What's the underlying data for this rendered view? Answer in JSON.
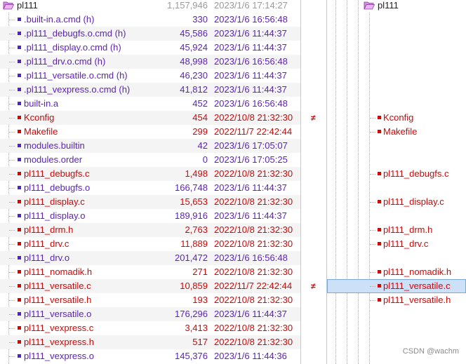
{
  "colors": {
    "changed": "#e00000",
    "unique": "#5a1ec8",
    "same": "#202020",
    "muted": "#9a9a9a",
    "folder": "#c87ad8"
  },
  "left": {
    "folder": {
      "name": "pl111",
      "size": "1,157,946",
      "date": "2023/1/6 17:14:27"
    },
    "rows": [
      {
        "name": ".built-in.a.cmd (h)",
        "size": "330",
        "date": "2023/1/6 16:56:48",
        "status": "unique"
      },
      {
        "name": ".pl111_debugfs.o.cmd (h)",
        "size": "45,586",
        "date": "2023/1/6 11:44:37",
        "status": "unique"
      },
      {
        "name": ".pl111_display.o.cmd (h)",
        "size": "45,924",
        "date": "2023/1/6 11:44:37",
        "status": "unique"
      },
      {
        "name": ".pl111_drv.o.cmd (h)",
        "size": "48,998",
        "date": "2023/1/6 16:56:48",
        "status": "unique"
      },
      {
        "name": ".pl111_versatile.o.cmd (h)",
        "size": "46,230",
        "date": "2023/1/6 11:44:37",
        "status": "unique"
      },
      {
        "name": ".pl111_vexpress.o.cmd (h)",
        "size": "41,812",
        "date": "2023/1/6 11:44:37",
        "status": "unique"
      },
      {
        "name": "built-in.a",
        "size": "452",
        "date": "2023/1/6 16:56:48",
        "status": "unique"
      },
      {
        "name": "Kconfig",
        "size": "454",
        "date": "2022/10/8 21:32:30",
        "status": "changed"
      },
      {
        "name": "Makefile",
        "size": "299",
        "date": "2022/11/7 22:42:44",
        "status": "changed"
      },
      {
        "name": "modules.builtin",
        "size": "42",
        "date": "2023/1/6 17:05:07",
        "status": "unique"
      },
      {
        "name": "modules.order",
        "size": "0",
        "date": "2023/1/6 17:05:25",
        "status": "unique"
      },
      {
        "name": "pl111_debugfs.c",
        "size": "1,498",
        "date": "2022/10/8 21:32:30",
        "status": "changed"
      },
      {
        "name": "pl111_debugfs.o",
        "size": "166,748",
        "date": "2023/1/6 11:44:37",
        "status": "unique"
      },
      {
        "name": "pl111_display.c",
        "size": "15,653",
        "date": "2022/10/8 21:32:30",
        "status": "changed"
      },
      {
        "name": "pl111_display.o",
        "size": "189,916",
        "date": "2023/1/6 11:44:37",
        "status": "unique"
      },
      {
        "name": "pl111_drm.h",
        "size": "2,763",
        "date": "2022/10/8 21:32:30",
        "status": "changed"
      },
      {
        "name": "pl111_drv.c",
        "size": "11,889",
        "date": "2022/10/8 21:32:30",
        "status": "changed"
      },
      {
        "name": "pl111_drv.o",
        "size": "201,472",
        "date": "2023/1/6 16:56:48",
        "status": "unique"
      },
      {
        "name": "pl111_nomadik.h",
        "size": "271",
        "date": "2022/10/8 21:32:30",
        "status": "changed"
      },
      {
        "name": "pl111_versatile.c",
        "size": "10,859",
        "date": "2022/11/7 22:42:44",
        "status": "changed"
      },
      {
        "name": "pl111_versatile.h",
        "size": "193",
        "date": "2022/10/8 21:32:30",
        "status": "changed"
      },
      {
        "name": "pl111_versatile.o",
        "size": "176,296",
        "date": "2023/1/6 11:44:37",
        "status": "unique"
      },
      {
        "name": "pl111_vexpress.c",
        "size": "3,413",
        "date": "2022/10/8 21:32:30",
        "status": "changed"
      },
      {
        "name": "pl111_vexpress.h",
        "size": "517",
        "date": "2022/10/8 21:32:30",
        "status": "changed"
      },
      {
        "name": "pl111_vexpress.o",
        "size": "145,376",
        "date": "2023/1/6 11:44:36",
        "status": "unique"
      }
    ]
  },
  "middle": {
    "marks": [
      {
        "row": 8,
        "symbol": "≠"
      },
      {
        "row": 20,
        "symbol": "≠"
      }
    ]
  },
  "right": {
    "folder": {
      "name": "pl111"
    },
    "selected_row": 20,
    "rows": [
      {
        "row": 8,
        "name": "Kconfig"
      },
      {
        "row": 9,
        "name": "Makefile"
      },
      {
        "row": 12,
        "name": "pl111_debugfs.c"
      },
      {
        "row": 14,
        "name": "pl111_display.c"
      },
      {
        "row": 16,
        "name": "pl111_drm.h"
      },
      {
        "row": 17,
        "name": "pl111_drv.c"
      },
      {
        "row": 19,
        "name": "pl111_nomadik.h"
      },
      {
        "row": 20,
        "name": "pl111_versatile.c"
      },
      {
        "row": 21,
        "name": "pl111_versatile.h"
      }
    ]
  },
  "watermark": "CSDN @wachm"
}
